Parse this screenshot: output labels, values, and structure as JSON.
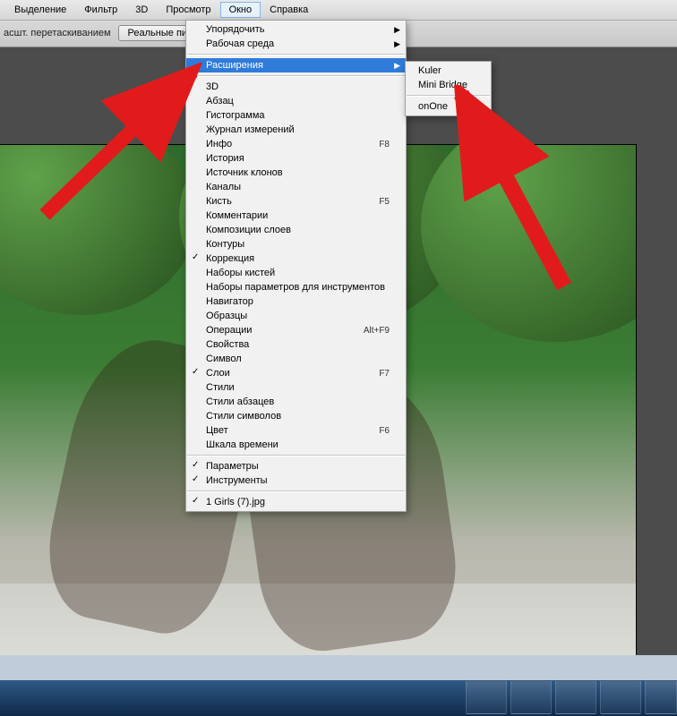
{
  "menubar": {
    "items": [
      "Выделение",
      "Фильтр",
      "3D",
      "Просмотр",
      "Окно",
      "Справка"
    ],
    "openIndex": 4
  },
  "optionsbar": {
    "drag_label": "асшт. перетаскиванием",
    "real_pixels_btn": "Реальные пикселы"
  },
  "window_menu": {
    "items": [
      {
        "label": "Упорядочить",
        "submenu": true
      },
      {
        "label": "Рабочая среда",
        "submenu": true
      },
      {
        "sep": true
      },
      {
        "label": "Расширения",
        "submenu": true,
        "highlight": true
      },
      {
        "sep": true
      },
      {
        "label": "3D"
      },
      {
        "label": "Абзац"
      },
      {
        "label": "Гистограмма"
      },
      {
        "label": "Журнал измерений"
      },
      {
        "label": "Инфо",
        "shortcut": "F8"
      },
      {
        "label": "История"
      },
      {
        "label": "Источник клонов"
      },
      {
        "label": "Каналы"
      },
      {
        "label": "Кисть",
        "shortcut": "F5"
      },
      {
        "label": "Комментарии"
      },
      {
        "label": "Композиции слоев"
      },
      {
        "label": "Контуры"
      },
      {
        "label": "Коррекция",
        "checked": true
      },
      {
        "label": "Наборы кистей"
      },
      {
        "label": "Наборы параметров для инструментов"
      },
      {
        "label": "Навигатор"
      },
      {
        "label": "Образцы"
      },
      {
        "label": "Операции",
        "shortcut": "Alt+F9"
      },
      {
        "label": "Свойства"
      },
      {
        "label": "Символ"
      },
      {
        "label": "Слои",
        "shortcut": "F7",
        "checked": true
      },
      {
        "label": "Стили"
      },
      {
        "label": "Стили абзацев"
      },
      {
        "label": "Стили символов"
      },
      {
        "label": "Цвет",
        "shortcut": "F6"
      },
      {
        "label": "Шкала времени"
      },
      {
        "sep": true
      },
      {
        "label": "Параметры",
        "checked": true
      },
      {
        "label": "Инструменты",
        "checked": true
      },
      {
        "sep": true
      },
      {
        "label": "1 Girls (7).jpg",
        "checked": true
      }
    ]
  },
  "extensions_submenu": {
    "items": [
      {
        "label": "Kuler"
      },
      {
        "label": "Mini Bridge"
      },
      {
        "sep": true
      },
      {
        "label": "onOne"
      }
    ]
  },
  "annotations": {
    "arrow_color": "#e11b1b"
  }
}
